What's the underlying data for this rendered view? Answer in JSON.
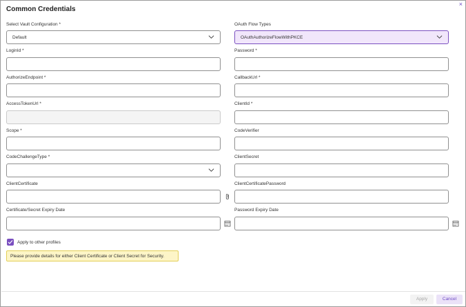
{
  "dialog": {
    "title": "Common Credentials",
    "close_glyph": "×"
  },
  "fields": {
    "vault_config": {
      "label": "Select Vault Configuration *",
      "value": "Default"
    },
    "oauth_flow": {
      "label": "OAuth Flow Types",
      "value": "OAuthAuthorizeFlowWithPKCE"
    },
    "login_id": {
      "label": "LoginId *",
      "value": ""
    },
    "password": {
      "label": "Password *",
      "value": ""
    },
    "authorize_endpoint": {
      "label": "AuthorizeEndpoint *",
      "value": ""
    },
    "callback_url": {
      "label": "CallbackUrl *",
      "value": ""
    },
    "access_token_url": {
      "label": "AccessTokenUrl *",
      "value": ""
    },
    "client_id": {
      "label": "ClientId *",
      "value": ""
    },
    "scope": {
      "label": "Scope *",
      "value": ""
    },
    "code_verifier": {
      "label": "CodeVerifier",
      "value": ""
    },
    "code_challenge_type": {
      "label": "CodeChallengeType *",
      "value": ""
    },
    "client_secret": {
      "label": "ClientSecret",
      "value": ""
    },
    "client_certificate": {
      "label": "ClientCertificate",
      "value": ""
    },
    "client_certificate_password": {
      "label": "ClientCertificatePassword",
      "value": ""
    },
    "cert_secret_expiry": {
      "label": "Certificate/Secret Expiry Date",
      "value": ""
    },
    "password_expiry": {
      "label": "Password Expiry Date",
      "value": ""
    }
  },
  "apply_other_profiles": {
    "label": "Apply to other profiles",
    "checked": true
  },
  "notice": "Please provide details for either Client Certificate or Client Secret for Security.",
  "footer": {
    "apply_label": "Apply",
    "cancel_label": "Cancel"
  },
  "colors": {
    "accent": "#7a4fc0",
    "notice_bg": "#fdf5c7",
    "selected_bg": "#f1e6fb"
  },
  "icons": {
    "dropdown": "chevron-down-icon",
    "attach": "paperclip-icon",
    "date": "calendar-icon"
  }
}
